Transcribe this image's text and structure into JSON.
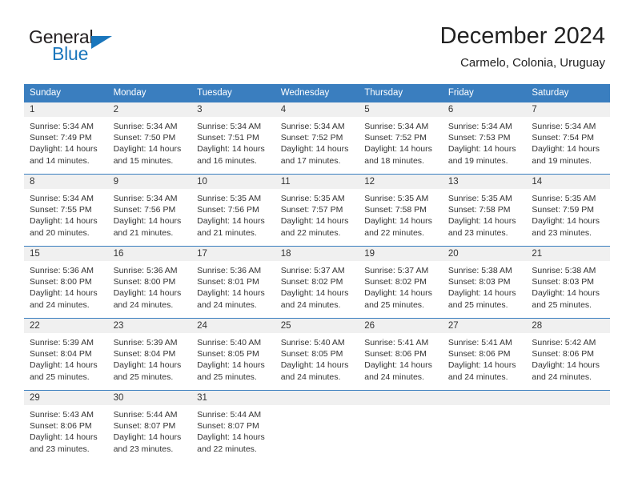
{
  "brand": {
    "name_part1": "General",
    "name_part2": "Blue",
    "accent_color": "#1a76bc"
  },
  "header": {
    "title": "December 2024",
    "location": "Carmelo, Colonia, Uruguay"
  },
  "calendar": {
    "header_color": "#3a7ebf",
    "daynum_band_color": "#f0f0f0",
    "weekdays": [
      "Sunday",
      "Monday",
      "Tuesday",
      "Wednesday",
      "Thursday",
      "Friday",
      "Saturday"
    ],
    "weeks": [
      [
        {
          "day": "1",
          "sunrise": "Sunrise: 5:34 AM",
          "sunset": "Sunset: 7:49 PM",
          "daylight1": "Daylight: 14 hours",
          "daylight2": "and 14 minutes."
        },
        {
          "day": "2",
          "sunrise": "Sunrise: 5:34 AM",
          "sunset": "Sunset: 7:50 PM",
          "daylight1": "Daylight: 14 hours",
          "daylight2": "and 15 minutes."
        },
        {
          "day": "3",
          "sunrise": "Sunrise: 5:34 AM",
          "sunset": "Sunset: 7:51 PM",
          "daylight1": "Daylight: 14 hours",
          "daylight2": "and 16 minutes."
        },
        {
          "day": "4",
          "sunrise": "Sunrise: 5:34 AM",
          "sunset": "Sunset: 7:52 PM",
          "daylight1": "Daylight: 14 hours",
          "daylight2": "and 17 minutes."
        },
        {
          "day": "5",
          "sunrise": "Sunrise: 5:34 AM",
          "sunset": "Sunset: 7:52 PM",
          "daylight1": "Daylight: 14 hours",
          "daylight2": "and 18 minutes."
        },
        {
          "day": "6",
          "sunrise": "Sunrise: 5:34 AM",
          "sunset": "Sunset: 7:53 PM",
          "daylight1": "Daylight: 14 hours",
          "daylight2": "and 19 minutes."
        },
        {
          "day": "7",
          "sunrise": "Sunrise: 5:34 AM",
          "sunset": "Sunset: 7:54 PM",
          "daylight1": "Daylight: 14 hours",
          "daylight2": "and 19 minutes."
        }
      ],
      [
        {
          "day": "8",
          "sunrise": "Sunrise: 5:34 AM",
          "sunset": "Sunset: 7:55 PM",
          "daylight1": "Daylight: 14 hours",
          "daylight2": "and 20 minutes."
        },
        {
          "day": "9",
          "sunrise": "Sunrise: 5:34 AM",
          "sunset": "Sunset: 7:56 PM",
          "daylight1": "Daylight: 14 hours",
          "daylight2": "and 21 minutes."
        },
        {
          "day": "10",
          "sunrise": "Sunrise: 5:35 AM",
          "sunset": "Sunset: 7:56 PM",
          "daylight1": "Daylight: 14 hours",
          "daylight2": "and 21 minutes."
        },
        {
          "day": "11",
          "sunrise": "Sunrise: 5:35 AM",
          "sunset": "Sunset: 7:57 PM",
          "daylight1": "Daylight: 14 hours",
          "daylight2": "and 22 minutes."
        },
        {
          "day": "12",
          "sunrise": "Sunrise: 5:35 AM",
          "sunset": "Sunset: 7:58 PM",
          "daylight1": "Daylight: 14 hours",
          "daylight2": "and 22 minutes."
        },
        {
          "day": "13",
          "sunrise": "Sunrise: 5:35 AM",
          "sunset": "Sunset: 7:58 PM",
          "daylight1": "Daylight: 14 hours",
          "daylight2": "and 23 minutes."
        },
        {
          "day": "14",
          "sunrise": "Sunrise: 5:35 AM",
          "sunset": "Sunset: 7:59 PM",
          "daylight1": "Daylight: 14 hours",
          "daylight2": "and 23 minutes."
        }
      ],
      [
        {
          "day": "15",
          "sunrise": "Sunrise: 5:36 AM",
          "sunset": "Sunset: 8:00 PM",
          "daylight1": "Daylight: 14 hours",
          "daylight2": "and 24 minutes."
        },
        {
          "day": "16",
          "sunrise": "Sunrise: 5:36 AM",
          "sunset": "Sunset: 8:00 PM",
          "daylight1": "Daylight: 14 hours",
          "daylight2": "and 24 minutes."
        },
        {
          "day": "17",
          "sunrise": "Sunrise: 5:36 AM",
          "sunset": "Sunset: 8:01 PM",
          "daylight1": "Daylight: 14 hours",
          "daylight2": "and 24 minutes."
        },
        {
          "day": "18",
          "sunrise": "Sunrise: 5:37 AM",
          "sunset": "Sunset: 8:02 PM",
          "daylight1": "Daylight: 14 hours",
          "daylight2": "and 24 minutes."
        },
        {
          "day": "19",
          "sunrise": "Sunrise: 5:37 AM",
          "sunset": "Sunset: 8:02 PM",
          "daylight1": "Daylight: 14 hours",
          "daylight2": "and 25 minutes."
        },
        {
          "day": "20",
          "sunrise": "Sunrise: 5:38 AM",
          "sunset": "Sunset: 8:03 PM",
          "daylight1": "Daylight: 14 hours",
          "daylight2": "and 25 minutes."
        },
        {
          "day": "21",
          "sunrise": "Sunrise: 5:38 AM",
          "sunset": "Sunset: 8:03 PM",
          "daylight1": "Daylight: 14 hours",
          "daylight2": "and 25 minutes."
        }
      ],
      [
        {
          "day": "22",
          "sunrise": "Sunrise: 5:39 AM",
          "sunset": "Sunset: 8:04 PM",
          "daylight1": "Daylight: 14 hours",
          "daylight2": "and 25 minutes."
        },
        {
          "day": "23",
          "sunrise": "Sunrise: 5:39 AM",
          "sunset": "Sunset: 8:04 PM",
          "daylight1": "Daylight: 14 hours",
          "daylight2": "and 25 minutes."
        },
        {
          "day": "24",
          "sunrise": "Sunrise: 5:40 AM",
          "sunset": "Sunset: 8:05 PM",
          "daylight1": "Daylight: 14 hours",
          "daylight2": "and 25 minutes."
        },
        {
          "day": "25",
          "sunrise": "Sunrise: 5:40 AM",
          "sunset": "Sunset: 8:05 PM",
          "daylight1": "Daylight: 14 hours",
          "daylight2": "and 24 minutes."
        },
        {
          "day": "26",
          "sunrise": "Sunrise: 5:41 AM",
          "sunset": "Sunset: 8:06 PM",
          "daylight1": "Daylight: 14 hours",
          "daylight2": "and 24 minutes."
        },
        {
          "day": "27",
          "sunrise": "Sunrise: 5:41 AM",
          "sunset": "Sunset: 8:06 PM",
          "daylight1": "Daylight: 14 hours",
          "daylight2": "and 24 minutes."
        },
        {
          "day": "28",
          "sunrise": "Sunrise: 5:42 AM",
          "sunset": "Sunset: 8:06 PM",
          "daylight1": "Daylight: 14 hours",
          "daylight2": "and 24 minutes."
        }
      ],
      [
        {
          "day": "29",
          "sunrise": "Sunrise: 5:43 AM",
          "sunset": "Sunset: 8:06 PM",
          "daylight1": "Daylight: 14 hours",
          "daylight2": "and 23 minutes."
        },
        {
          "day": "30",
          "sunrise": "Sunrise: 5:44 AM",
          "sunset": "Sunset: 8:07 PM",
          "daylight1": "Daylight: 14 hours",
          "daylight2": "and 23 minutes."
        },
        {
          "day": "31",
          "sunrise": "Sunrise: 5:44 AM",
          "sunset": "Sunset: 8:07 PM",
          "daylight1": "Daylight: 14 hours",
          "daylight2": "and 22 minutes."
        },
        {
          "day": "",
          "sunrise": "",
          "sunset": "",
          "daylight1": "",
          "daylight2": ""
        },
        {
          "day": "",
          "sunrise": "",
          "sunset": "",
          "daylight1": "",
          "daylight2": ""
        },
        {
          "day": "",
          "sunrise": "",
          "sunset": "",
          "daylight1": "",
          "daylight2": ""
        },
        {
          "day": "",
          "sunrise": "",
          "sunset": "",
          "daylight1": "",
          "daylight2": ""
        }
      ]
    ]
  }
}
